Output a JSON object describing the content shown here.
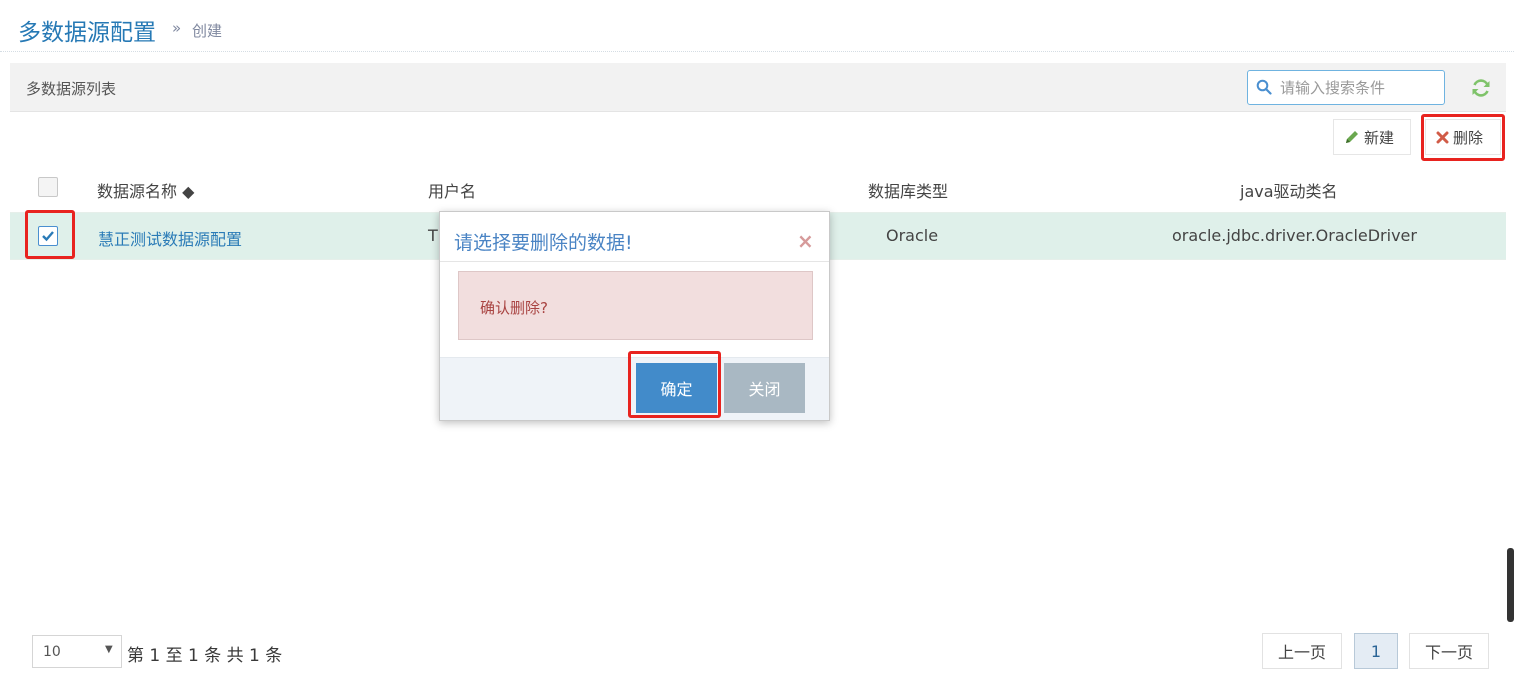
{
  "header": {
    "title": "多数据源配置",
    "breadcrumb_sep": "»",
    "breadcrumb": "创建"
  },
  "widget": {
    "title": "多数据源列表"
  },
  "search": {
    "placeholder": "请输入搜索条件"
  },
  "toolbar": {
    "new_label": "新建",
    "delete_label": "删除"
  },
  "table": {
    "columns": [
      "数据源名称 ◆",
      "用户名",
      "数据库类型",
      "java驱动类名"
    ],
    "rows": [
      {
        "checked": true,
        "name": "慧正测试数据源配置",
        "username": "T",
        "db_type": "Oracle",
        "driver": "oracle.jdbc.driver.OracleDriver"
      }
    ]
  },
  "dialog": {
    "title": "请选择要删除的数据!",
    "close_symbol": "×",
    "message": "确认删除?",
    "confirm_label": "确定",
    "close_label": "关闭"
  },
  "pagination": {
    "page_length": "10",
    "info": "第 1 至 1 条 共 1 条",
    "prev_label": "上一页",
    "current_page": "1",
    "next_label": "下一页"
  },
  "colors": {
    "title_blue": "#2679b5",
    "highlight_red": "#e8231f",
    "row_selected": "#dff0ea",
    "confirm_blue": "#428bca",
    "alert_bg": "#f2dede"
  }
}
